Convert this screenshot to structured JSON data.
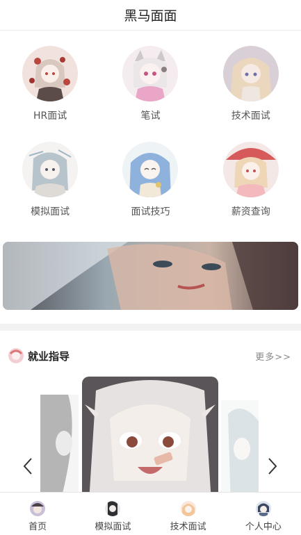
{
  "header": {
    "title": "黑马面面"
  },
  "grid": [
    {
      "label": "HR面试",
      "icon": "anime-girl-roses-avatar",
      "colors": [
        "#f1d5cf",
        "#b9473f"
      ]
    },
    {
      "label": "笔试",
      "icon": "anime-girl-catears-avatar",
      "colors": [
        "#f3dde6",
        "#e6a6c6"
      ]
    },
    {
      "label": "技术面试",
      "icon": "anime-girl-blonde-avatar",
      "colors": [
        "#e8d9c9",
        "#c9a6a4"
      ]
    },
    {
      "label": "模拟面试",
      "icon": "anime-girl-sketch-avatar",
      "colors": [
        "#ecebea",
        "#9fb6c5"
      ]
    },
    {
      "label": "面试技巧",
      "icon": "anime-girl-blue-hair-avatar",
      "colors": [
        "#e3eef4",
        "#7fa6d6"
      ]
    },
    {
      "label": "薪资查询",
      "icon": "anime-girl-umbrella-avatar",
      "colors": [
        "#f6d9d6",
        "#d65a5a"
      ]
    }
  ],
  "banner": {
    "icon": "anime-banner-image",
    "colors": [
      "#3b3e46",
      "#b8c6cf"
    ]
  },
  "section": {
    "title": "就业指导",
    "more": "更多>>",
    "icon": "anime-section-avatar"
  },
  "carousel": {
    "slides": [
      "anime-dark-hair-slide",
      "anime-bandage-girl-slide",
      "anime-sketch-slide"
    ]
  },
  "tabs": [
    {
      "label": "首页",
      "icon": "home-avatar-icon"
    },
    {
      "label": "模拟面试",
      "icon": "mock-interview-avatar-icon"
    },
    {
      "label": "技术面试",
      "icon": "tech-interview-avatar-icon"
    },
    {
      "label": "个人中心",
      "icon": "profile-avatar-icon"
    }
  ]
}
